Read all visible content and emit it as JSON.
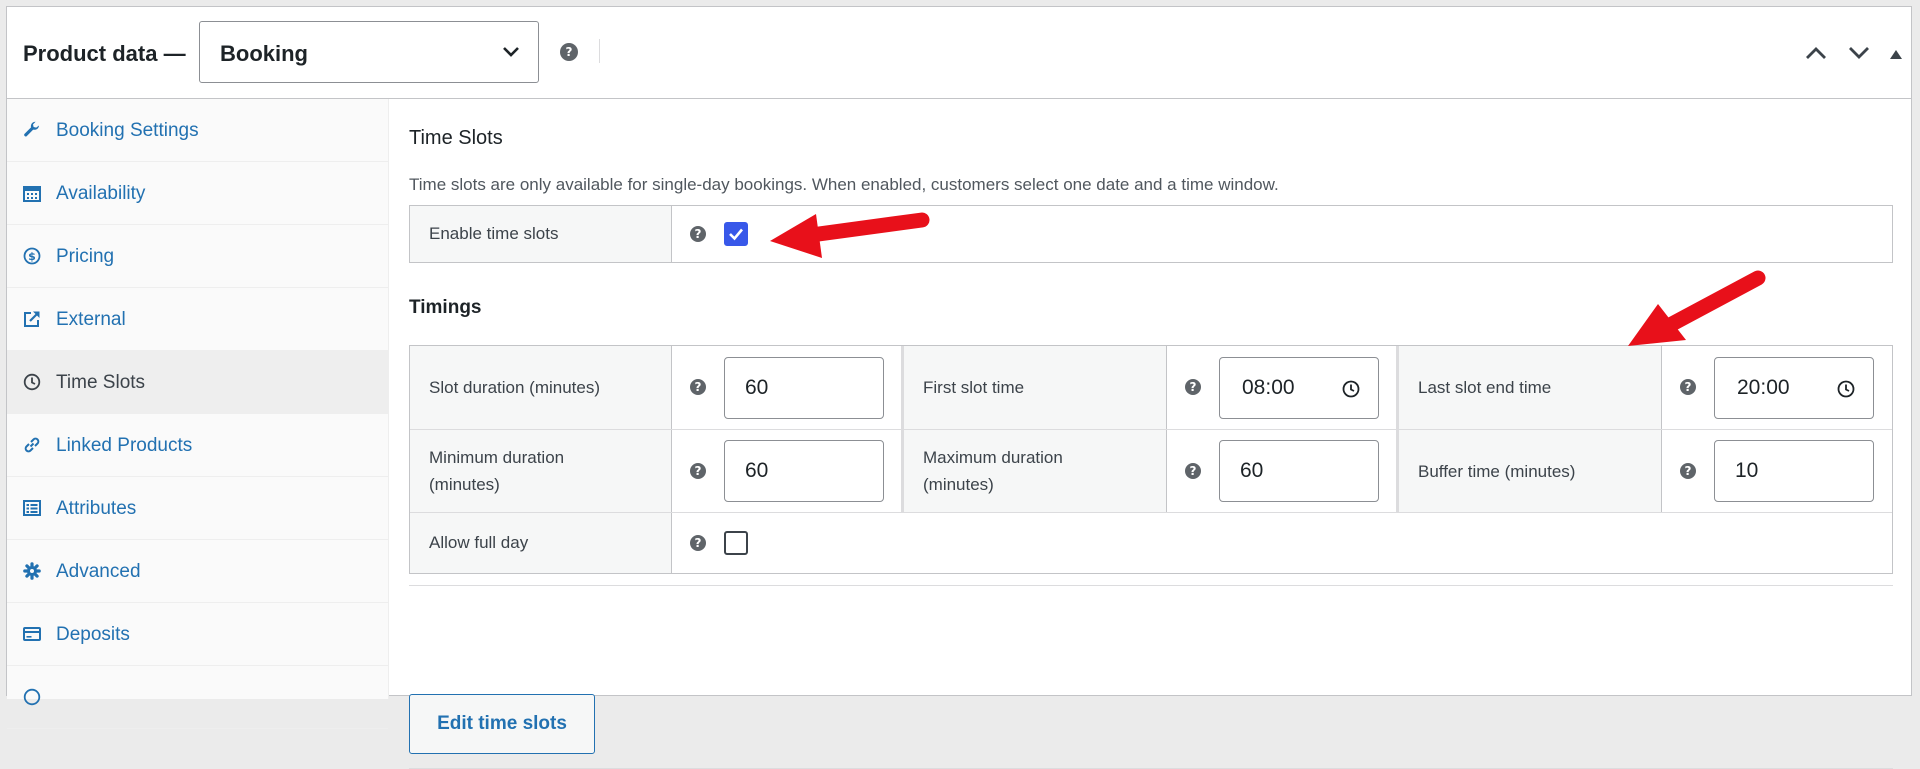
{
  "header": {
    "title": "Product data —",
    "product_type": "Booking"
  },
  "sidebar": {
    "items": [
      {
        "label": "Booking Settings",
        "icon": "wrench-icon"
      },
      {
        "label": "Availability",
        "icon": "calendar-icon"
      },
      {
        "label": "Pricing",
        "icon": "dollar-icon"
      },
      {
        "label": "External",
        "icon": "external-link-icon"
      },
      {
        "label": "Time Slots",
        "icon": "clock-icon",
        "active": true
      },
      {
        "label": "Linked Products",
        "icon": "link-icon"
      },
      {
        "label": "Attributes",
        "icon": "list-icon"
      },
      {
        "label": "Advanced",
        "icon": "gear-icon"
      },
      {
        "label": "Deposits",
        "icon": "card-icon"
      }
    ]
  },
  "time_slots": {
    "title": "Time Slots",
    "description": "Time slots are only available for single-day bookings. When enabled, customers select one date and a time window.",
    "enable_label": "Enable time slots",
    "enable_checked": true
  },
  "timings": {
    "title": "Timings",
    "slot_duration_label": "Slot duration (minutes)",
    "slot_duration_value": "60",
    "first_slot_label": "First slot time",
    "first_slot_value": "08:00",
    "last_slot_label": "Last slot end time",
    "last_slot_value": "20:00",
    "min_duration_label": "Minimum duration (minutes)",
    "min_duration_value": "60",
    "max_duration_label": "Maximum duration (minutes)",
    "max_duration_value": "60",
    "buffer_label": "Buffer time (minutes)",
    "buffer_value": "10",
    "full_day_label": "Allow full day",
    "full_day_checked": false
  },
  "edit_button_label": "Edit time slots",
  "colors": {
    "link": "#2271b1",
    "checkbox": "#3858e9",
    "annotation_arrow": "#e8101a"
  }
}
